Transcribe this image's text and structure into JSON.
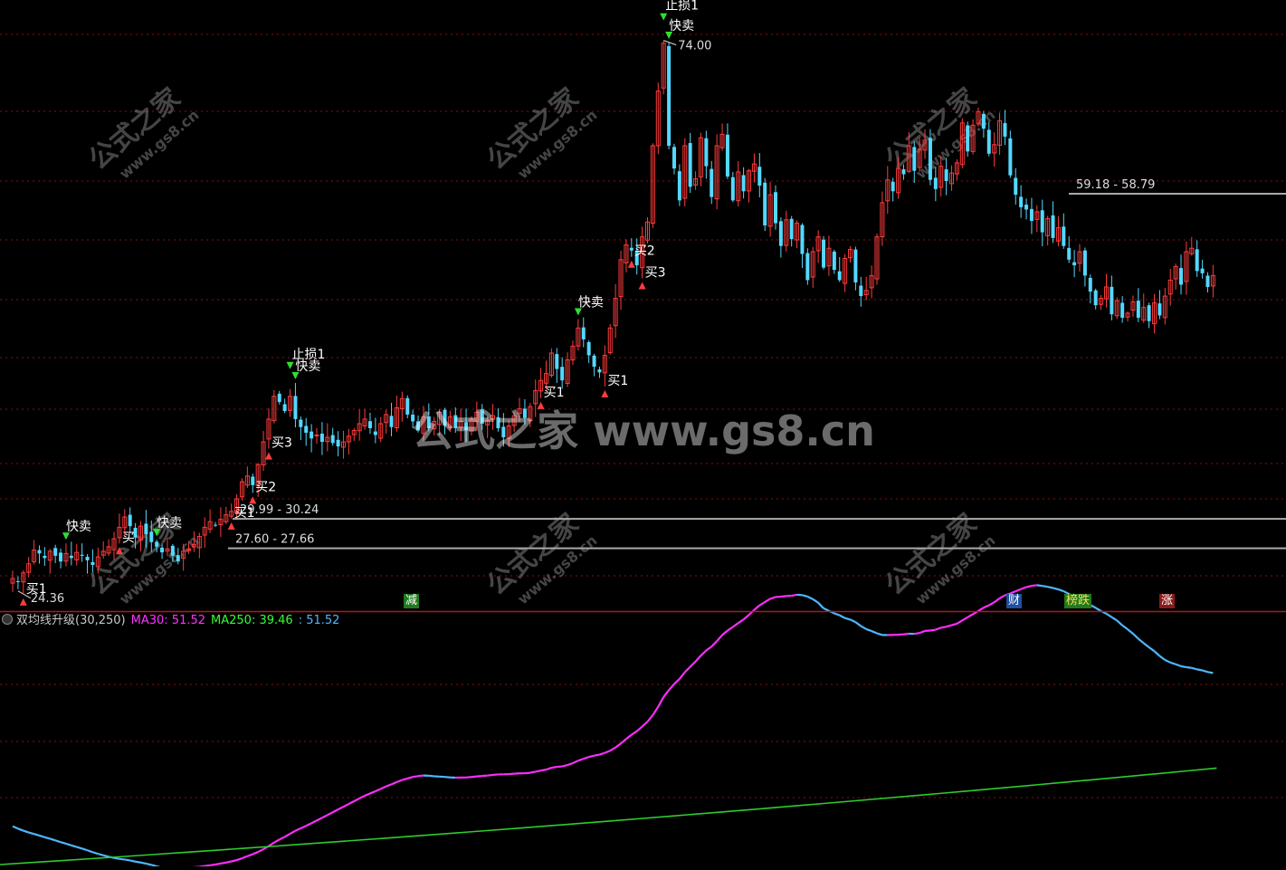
{
  "indicator": {
    "name": "双均线升级(30,250)",
    "ma30_label": "MA30: 51.52",
    "ma250_label": "MA250: 39.46",
    "extra_label": ": 51.52"
  },
  "colors": {
    "up": "#ff3b3b",
    "down": "#54d8ff",
    "ma30": "#ff2eff",
    "ma30_flat": "#4db8ff",
    "ma250": "#2ecc2e",
    "grid": "#8b1010",
    "level_line": "#aaaaaa"
  },
  "watermark": {
    "center": "公式之家 www.gs8.cn",
    "tile_main": "公式之家",
    "tile_sub": "www.gs8.cn"
  },
  "top_flags": [
    {
      "label": "减",
      "bg": "#1f7a1f",
      "color": "#ffffff"
    },
    {
      "label": "财",
      "bg": "#1f4fa0",
      "color": "#ffffff"
    },
    {
      "label": "榜跌",
      "bg": "#1f7a1f",
      "color": "#ffdd55"
    },
    {
      "label": "涨",
      "bg": "#8a1a1a",
      "color": "#ffffff"
    }
  ],
  "chart_data": [
    {
      "type": "candlestick",
      "title": "",
      "price_range": [
        22.7,
        75.0
      ],
      "annotations": {
        "high_label": "74.00",
        "low_label": "24.36",
        "levels": [
          {
            "label": "59.18 - 58.79",
            "price": 58.79
          },
          {
            "label": "29.99 - 30.24",
            "price": 30.24
          },
          {
            "label": "27.60 - 27.66",
            "price": 27.66
          }
        ],
        "signals": [
          {
            "label": "买1",
            "kind": "buy",
            "candle": 2
          },
          {
            "label": "快卖",
            "kind": "sell",
            "candle": 10
          },
          {
            "label": "买",
            "kind": "buy",
            "candle": 20
          },
          {
            "label": "快卖",
            "kind": "sell",
            "candle": 27
          },
          {
            "label": "买1",
            "kind": "buy",
            "candle": 41
          },
          {
            "label": "买2",
            "kind": "buy",
            "candle": 45
          },
          {
            "label": "买3",
            "kind": "buy",
            "candle": 48
          },
          {
            "label": "止损1",
            "kind": "stop",
            "candle": 52
          },
          {
            "label": "快卖",
            "kind": "sell",
            "candle": 53
          },
          {
            "label": "买1",
            "kind": "buy",
            "candle": 99
          },
          {
            "label": "快卖",
            "kind": "sell",
            "candle": 106
          },
          {
            "label": "买1",
            "kind": "buy",
            "candle": 111
          },
          {
            "label": "买2",
            "kind": "buy",
            "candle": 116
          },
          {
            "label": "买3",
            "kind": "buy",
            "candle": 118
          },
          {
            "label": "止损1",
            "kind": "stop",
            "candle": 122
          },
          {
            "label": "快卖",
            "kind": "sell",
            "candle": 123
          }
        ]
      },
      "closes": [
        25.0,
        24.7,
        25.5,
        26.3,
        27.5,
        27.2,
        26.8,
        27.4,
        27.0,
        26.5,
        27.2,
        26.8,
        27.3,
        27.0,
        26.6,
        26.2,
        26.9,
        27.4,
        27.8,
        28.5,
        29.5,
        30.4,
        29.6,
        28.6,
        29.6,
        28.9,
        28.2,
        27.8,
        27.3,
        27.6,
        27.0,
        26.5,
        27.4,
        27.6,
        28.0,
        28.7,
        29.5,
        30.0,
        29.7,
        30.2,
        30.6,
        30.9,
        32.0,
        33.5,
        34.0,
        33.2,
        35.0,
        37.0,
        39.0,
        41.0,
        40.5,
        39.7,
        41.0,
        39.0,
        38.3,
        37.8,
        37.3,
        37.6,
        37.0,
        37.4,
        36.9,
        36.6,
        37.0,
        37.5,
        38.0,
        38.6,
        39.0,
        38.2,
        37.6,
        38.6,
        39.4,
        38.3,
        40.0,
        40.8,
        39.4,
        38.8,
        38.0,
        39.2,
        38.2,
        38.8,
        39.6,
        38.4,
        39.2,
        38.2,
        38.8,
        38.0,
        39.0,
        39.6,
        38.6,
        38.9,
        39.3,
        38.2,
        37.4,
        38.4,
        39.3,
        39.9,
        39.1,
        40.1,
        41.5,
        42.4,
        43.0,
        44.8,
        43.4,
        42.4,
        44.2,
        45.4,
        47.0,
        46.0,
        44.6,
        43.6,
        43.1,
        44.6,
        47.0,
        49.6,
        53.0,
        54.3,
        53.8,
        52.5,
        55.0,
        56.3,
        63.0,
        67.8,
        72.0,
        63.0,
        61.0,
        58.2,
        63.0,
        59.4,
        60.1,
        63.7,
        61.2,
        58.5,
        63.0,
        64.0,
        60.3,
        58.2,
        60.7,
        59.0,
        60.8,
        61.4,
        59.5,
        56.0,
        58.7,
        56.2,
        54.2,
        56.5,
        54.8,
        56.2,
        53.5,
        51.2,
        53.7,
        55.0,
        52.3,
        54.0,
        52.1,
        51.2,
        53.1,
        53.9,
        51.0,
        49.8,
        50.3,
        51.6,
        55.0,
        58.0,
        60.0,
        59.0,
        61.0,
        60.5,
        63.0,
        60.8,
        62.7,
        63.5,
        60.0,
        59.2,
        61.2,
        59.9,
        60.6,
        61.5,
        65.0,
        62.5,
        64.8,
        66.0,
        64.5,
        62.3,
        63.1,
        65.2,
        63.8,
        60.4,
        58.7,
        57.6,
        57.4,
        56.4,
        57.2,
        55.4,
        56.6,
        54.9,
        55.8,
        54.2,
        53.0,
        52.5,
        53.7,
        51.6,
        50.2,
        49.0,
        49.6,
        50.6,
        48.2,
        49.4,
        47.9,
        48.3,
        49.3,
        47.9,
        48.8,
        47.6,
        49.2,
        48.1,
        49.8,
        51.2,
        52.4,
        50.8,
        53.7,
        54.0,
        52.0,
        51.8,
        50.6,
        51.6
      ]
    },
    {
      "type": "line",
      "title": "双均线升级(30,250)",
      "series": [
        {
          "name": "MA30",
          "y_start": 32.8,
          "y_end": 51.52,
          "y_max": 55.5
        },
        {
          "name": "MA250",
          "y_start": 28.0,
          "y_end": 39.46
        }
      ],
      "y_range": [
        28.0,
        56.5
      ]
    }
  ]
}
